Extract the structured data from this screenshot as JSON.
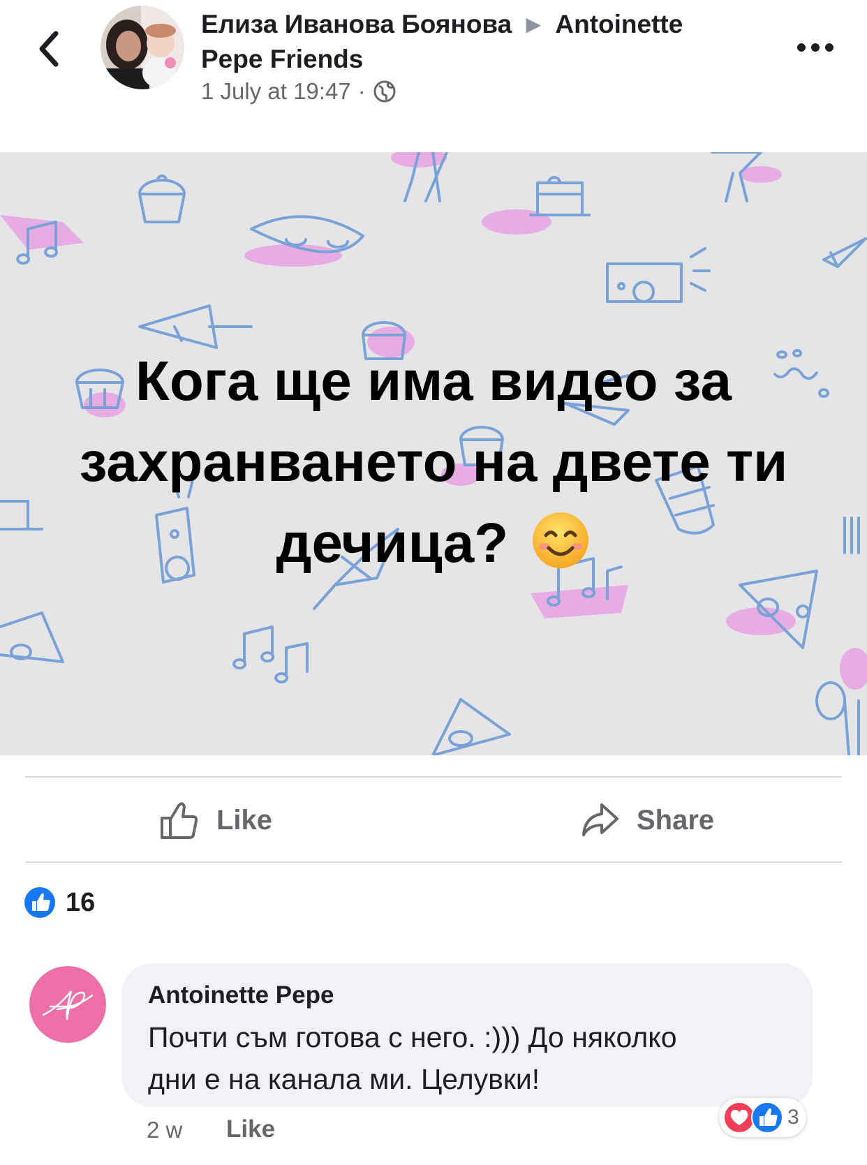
{
  "header": {
    "author": "Елиза Иванова Боянова",
    "arrow": "▶",
    "target_line1": "Antoinette",
    "target_line2": "Pepe Friends",
    "timestamp": "1 July at 19:47",
    "separator": "·",
    "icons": {
      "back": "chevron-left-icon",
      "privacy": "globe-icon",
      "more": "more-dots-icon"
    }
  },
  "post": {
    "text": "Кога ще има видео за захранването на двете ти дечица?",
    "emoji": "smiling-face-emoji",
    "background_color": "#e5e5e7",
    "doodle_color": "#7aa2d6",
    "highlight_color": "#e88ee0"
  },
  "actions": {
    "like_label": "Like",
    "share_label": "Share"
  },
  "reactions_summary": {
    "count": "16",
    "icon": "like-reaction-icon",
    "accent": "#1877f2"
  },
  "comment": {
    "author": "Antoinette Pepe",
    "text_line1": "Почти съм готова с него. :))) До няколко",
    "text_line2": "дни е на канала ми. Целувки!",
    "time": "2 w",
    "like_label": "Like",
    "reaction_count": "3",
    "avatar_color": "#ee6ea8"
  }
}
